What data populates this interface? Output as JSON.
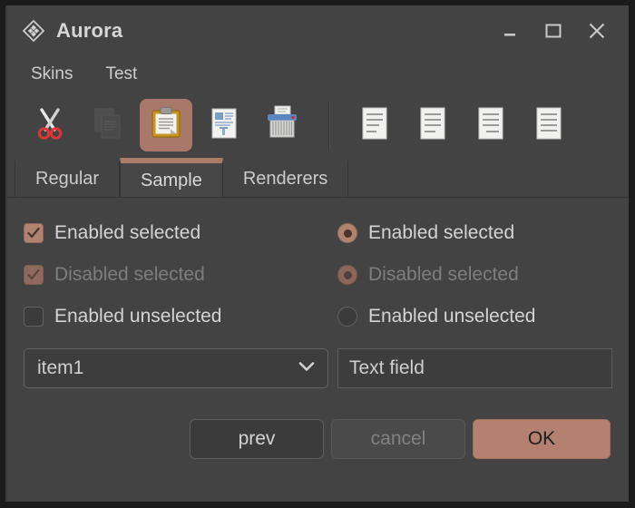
{
  "window": {
    "title": "Aurora",
    "logo_icon": "aurora-diamond-logo",
    "controls": [
      {
        "name": "minimize",
        "icon": "minimize-icon"
      },
      {
        "name": "maximize",
        "icon": "maximize-icon"
      },
      {
        "name": "close",
        "icon": "close-icon"
      }
    ]
  },
  "menubar": {
    "items": [
      {
        "label": "Skins"
      },
      {
        "label": "Test"
      }
    ]
  },
  "toolbar": {
    "buttons": [
      {
        "name": "cut",
        "icon": "scissors-icon",
        "state": "enabled"
      },
      {
        "name": "copy",
        "icon": "copy-documents-icon",
        "state": "disabled"
      },
      {
        "name": "paste",
        "icon": "clipboard-paste-icon",
        "state": "selected"
      },
      {
        "name": "paste-special",
        "icon": "document-text-icon",
        "state": "enabled"
      },
      {
        "name": "shred",
        "icon": "paper-shredder-icon",
        "state": "enabled"
      }
    ],
    "align_buttons": [
      {
        "name": "align-left",
        "icon": "align-left-icon"
      },
      {
        "name": "align-right",
        "icon": "align-right-icon"
      },
      {
        "name": "align-center",
        "icon": "align-center-icon"
      },
      {
        "name": "align-justify",
        "icon": "align-justify-icon"
      }
    ]
  },
  "tabs": [
    {
      "label": "Regular",
      "active": false
    },
    {
      "label": "Sample",
      "active": true
    },
    {
      "label": "Renderers",
      "active": false
    }
  ],
  "sample": {
    "checkboxes": [
      {
        "label": "Enabled selected",
        "checked": true,
        "enabled": true
      },
      {
        "label": "Disabled selected",
        "checked": true,
        "enabled": false
      },
      {
        "label": "Enabled unselected",
        "checked": false,
        "enabled": true
      }
    ],
    "radios": [
      {
        "label": "Enabled selected",
        "checked": true,
        "enabled": true
      },
      {
        "label": "Disabled selected",
        "checked": true,
        "enabled": false
      },
      {
        "label": "Enabled unselected",
        "checked": false,
        "enabled": true
      }
    ],
    "combobox": {
      "value": "item1",
      "icon": "chevron-down-icon"
    },
    "textfield": {
      "value": "Text field",
      "placeholder": "Text field"
    },
    "buttons": [
      {
        "label": "prev",
        "style": "normal"
      },
      {
        "label": "cancel",
        "style": "disabled"
      },
      {
        "label": "OK",
        "style": "default"
      }
    ]
  },
  "colors": {
    "accent": "#b08270",
    "accent_button": "#b48171",
    "window_bg": "#434343",
    "frame": "#1b1b1b",
    "text": "#d4d4d4",
    "text_dim": "#7e7e7e"
  }
}
